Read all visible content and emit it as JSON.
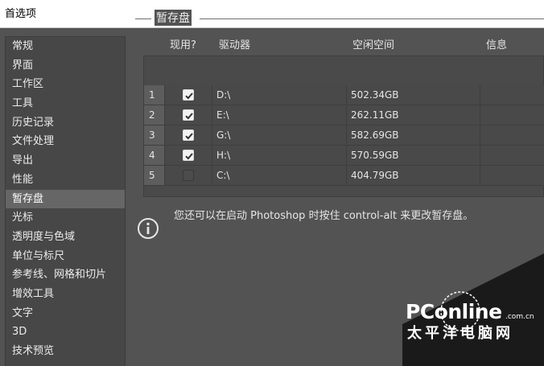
{
  "window": {
    "title": "首选项"
  },
  "sidebar": {
    "items": [
      {
        "label": "常规"
      },
      {
        "label": "界面"
      },
      {
        "label": "工作区"
      },
      {
        "label": "工具"
      },
      {
        "label": "历史记录"
      },
      {
        "label": "文件处理"
      },
      {
        "label": "导出"
      },
      {
        "label": "性能"
      },
      {
        "label": "暂存盘",
        "active": true
      },
      {
        "label": "光标"
      },
      {
        "label": "透明度与色域"
      },
      {
        "label": "单位与标尺"
      },
      {
        "label": "参考线、网格和切片"
      },
      {
        "label": "增效工具"
      },
      {
        "label": "文字"
      },
      {
        "label": "3D"
      },
      {
        "label": "技术预览"
      }
    ]
  },
  "scratch": {
    "group_title": "暂存盘",
    "columns": {
      "active": "现用?",
      "drive": "驱动器",
      "free_space": "空闲空间",
      "info": "信息"
    },
    "rows": [
      {
        "index": "1",
        "checked": true,
        "drive": "D:\\",
        "free_space": "502.34GB",
        "info": ""
      },
      {
        "index": "2",
        "checked": true,
        "drive": "E:\\",
        "free_space": "262.11GB",
        "info": ""
      },
      {
        "index": "3",
        "checked": true,
        "drive": "G:\\",
        "free_space": "582.69GB",
        "info": ""
      },
      {
        "index": "4",
        "checked": true,
        "drive": "H:\\",
        "free_space": "570.59GB",
        "info": ""
      },
      {
        "index": "5",
        "checked": false,
        "drive": "C:\\",
        "free_space": "404.79GB",
        "info": ""
      }
    ],
    "note": "您还可以在启动 Photoshop 时按住 control-alt 来更改暂存盘。"
  },
  "watermark": {
    "logo": "PConline",
    "domain": ".com.cn",
    "cn": "太平洋电脑网"
  },
  "colors": {
    "panel": "#535353",
    "sidebar": "#474747",
    "selected": "#666666",
    "table": "#4a4a4a"
  },
  "icons": {
    "info": "info-circle-icon",
    "check": "checkmark-icon"
  }
}
